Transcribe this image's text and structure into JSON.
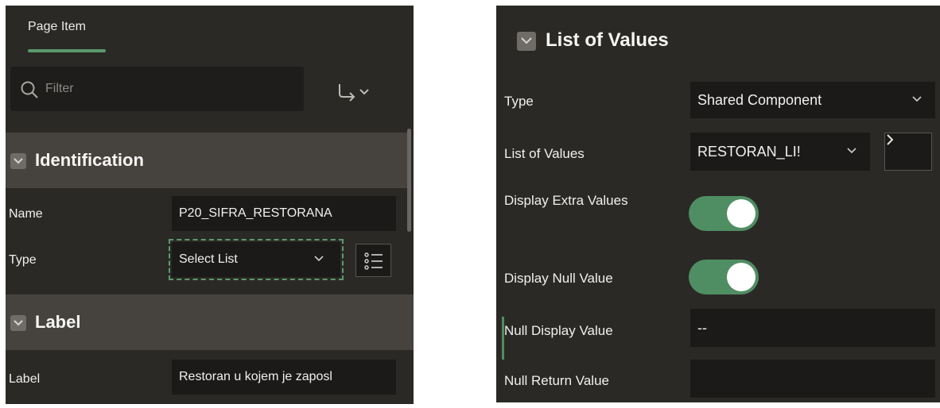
{
  "left": {
    "tab_label": "Page Item",
    "filter_placeholder": "Filter",
    "identification": {
      "title": "Identification",
      "name_label": "Name",
      "name_value": "P20_SIFRA_RESTORANA",
      "type_label": "Type",
      "type_value": "Select List"
    },
    "label_section": {
      "title": "Label",
      "label_label": "Label",
      "label_value": "Restoran u kojem je zaposl"
    }
  },
  "right": {
    "title": "List of Values",
    "type_label": "Type",
    "type_value": "Shared Component",
    "lov_label": "List of Values",
    "lov_value": "RESTORAN_LI!",
    "display_extra_label": "Display Extra Values",
    "display_extra_on": true,
    "display_null_label": "Display Null Value",
    "display_null_on": true,
    "null_display_label": "Null Display Value",
    "null_display_value": "--",
    "null_return_label": "Null Return Value",
    "null_return_value": ""
  },
  "colors": {
    "panel_bg": "#2b2926",
    "section_bg": "#46433f",
    "field_bg": "#1c1a18",
    "accent_green": "#4f8e62"
  }
}
